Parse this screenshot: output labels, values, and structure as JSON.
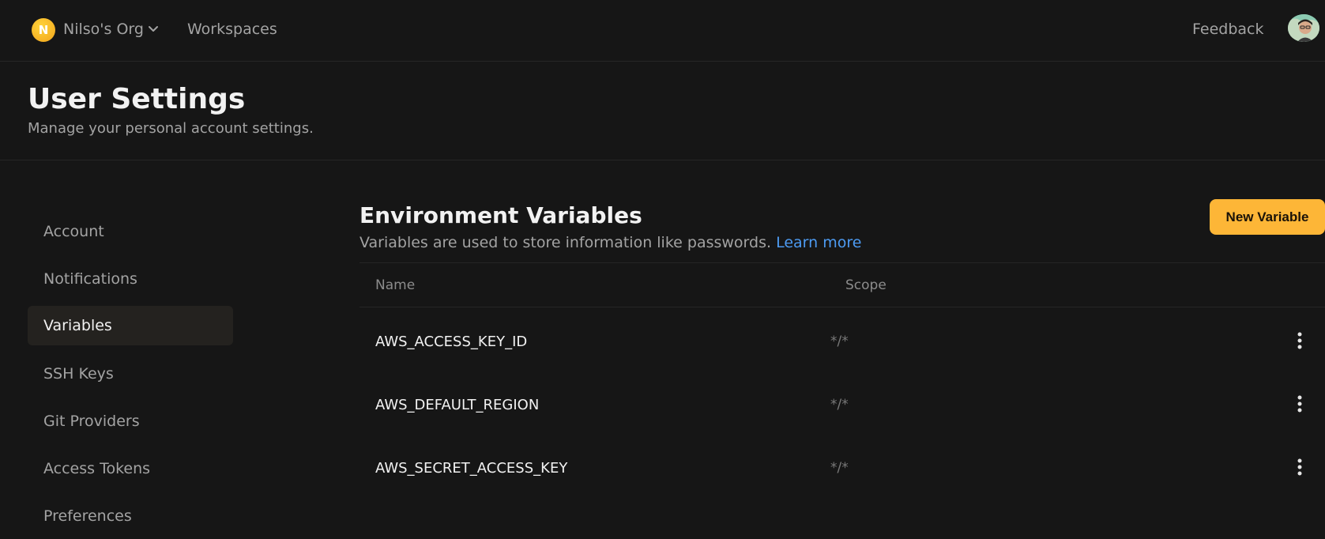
{
  "topbar": {
    "org_initial": "N",
    "org_name": "Nilso's Org",
    "workspaces_label": "Workspaces",
    "feedback_label": "Feedback"
  },
  "header": {
    "title": "User Settings",
    "subtitle": "Manage your personal account settings."
  },
  "sidebar": {
    "items": [
      {
        "label": "Account",
        "active": false
      },
      {
        "label": "Notifications",
        "active": false
      },
      {
        "label": "Variables",
        "active": true
      },
      {
        "label": "SSH Keys",
        "active": false
      },
      {
        "label": "Git Providers",
        "active": false
      },
      {
        "label": "Access Tokens",
        "active": false
      },
      {
        "label": "Preferences",
        "active": false
      }
    ]
  },
  "main": {
    "title": "Environment Variables",
    "description": "Variables are used to store information like passwords.",
    "learn_more": "Learn more",
    "new_variable_label": "New Variable",
    "table": {
      "columns": [
        "Name",
        "Scope"
      ],
      "rows": [
        {
          "name": "AWS_ACCESS_KEY_ID",
          "scope": "*/*"
        },
        {
          "name": "AWS_DEFAULT_REGION",
          "scope": "*/*"
        },
        {
          "name": "AWS_SECRET_ACCESS_KEY",
          "scope": "*/*"
        }
      ]
    }
  },
  "colors": {
    "accent": "#fdb637",
    "link": "#4d9bf2",
    "background": "#161616"
  }
}
